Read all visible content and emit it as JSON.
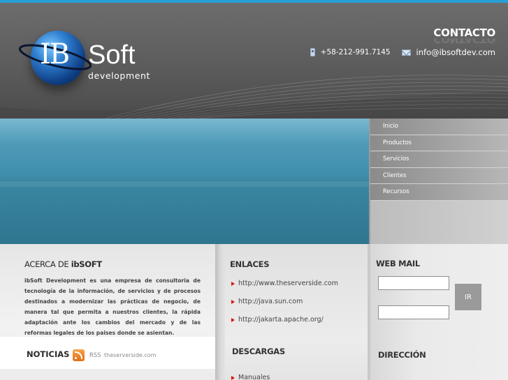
{
  "header": {
    "logo": {
      "ib": "IB",
      "soft": "Soft",
      "development": "development"
    },
    "contact": {
      "title": "CONTACTO",
      "phone": "+58-212-991.7145",
      "email": "info@ibsoftdev.com"
    }
  },
  "nav": {
    "items": [
      {
        "label": "Inicio"
      },
      {
        "label": "Productos"
      },
      {
        "label": "Servicios"
      },
      {
        "label": "Clientes"
      },
      {
        "label": "Recursos"
      }
    ]
  },
  "acerca": {
    "title_prefix": "ACERCA DE ",
    "title_brand": "ibSOFT",
    "text": "ibSoft Development es una empresa de consultoria de tecnología de la información, de servicios y de procesos destinados a modernizar las prácticas de negocio, de manera tal que permita a nuestros clientes, la rápida adaptación ante los cambios del mercado y de las reformas legales de los paises donde se asientan."
  },
  "noticias": {
    "title": "NOTICIAS",
    "rss_label": "RSS",
    "source": "theserverside.com"
  },
  "enlaces": {
    "title": "ENLACES",
    "links": [
      {
        "label": "http://www.theserverside.com"
      },
      {
        "label": "http://java.sun.com"
      },
      {
        "label": "http://jakarta.apache.org/"
      }
    ]
  },
  "descargas": {
    "title": "DESCARGAS",
    "items": [
      {
        "label": "Manuales"
      }
    ]
  },
  "webmail": {
    "title": "WEB MAIL",
    "button_label": "IR",
    "user_value": "",
    "password_value": ""
  },
  "direccion": {
    "title": "DIRECCIÓN"
  },
  "colors": {
    "accent_line": "#2a9fd6",
    "header_bg": "#5c5c5c",
    "banner_blue": "#3f8eab",
    "link_arrow": "#e01010"
  },
  "icons": {
    "phone": "phone-icon",
    "mail": "mail-icon",
    "rss": "rss-icon",
    "link_bullet": "arrow-right-icon"
  }
}
